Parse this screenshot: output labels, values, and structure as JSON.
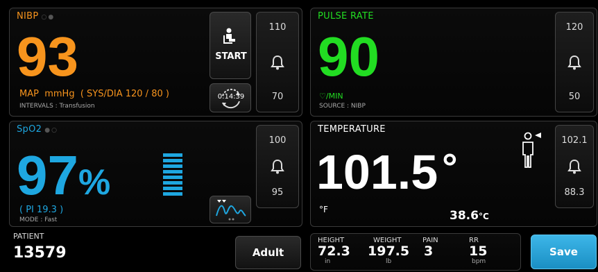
{
  "nibp": {
    "title": "NIBP",
    "value": "93",
    "map_line": "MAP  mmHg  ( SYS/DIA 120 / 80 )",
    "intervals": "INTERVALS : Transfusion",
    "start_label": "START",
    "timer": "0:14:39",
    "limit_high": "110",
    "limit_low": "70",
    "color": "#f7941d"
  },
  "pulse": {
    "title": "PULSE RATE",
    "value": "90",
    "unit": "/MIN",
    "source": "SOURCE : NIBP",
    "limit_high": "120",
    "limit_low": "50",
    "color": "#22dd22"
  },
  "spo2": {
    "title": "SpO2",
    "value": "97",
    "percent": "%",
    "pi": "( PI 19.3 )",
    "mode": "MODE : Fast",
    "limit_high": "100",
    "limit_low": "95",
    "color": "#1ea7e1"
  },
  "temperature": {
    "title": "TEMPERATURE",
    "value": "101.5",
    "degree": "°",
    "unit_f": "°F",
    "celsius": "38.6",
    "unit_c": "°C",
    "limit_high": "102.1",
    "limit_low": "88.3"
  },
  "patient": {
    "label": "PATIENT",
    "id": "13579",
    "type_button": "Adult"
  },
  "manual": {
    "height_label": "HEIGHT",
    "height_value": "72.3",
    "height_unit": "in",
    "weight_label": "WEIGHT",
    "weight_value": "197.5",
    "weight_unit": "lb",
    "pain_label": "PAIN",
    "pain_value": "3",
    "rr_label": "RR",
    "rr_value": "15",
    "rr_unit": "bpm"
  },
  "save_label": "Save",
  "icons": {
    "bell": "bell-icon",
    "start": "patient-seated-icon",
    "timer": "interval-timer-icon",
    "waveform": "pleth-waveform-icon",
    "standing": "patient-standing-icon",
    "heart": "heart-icon"
  }
}
